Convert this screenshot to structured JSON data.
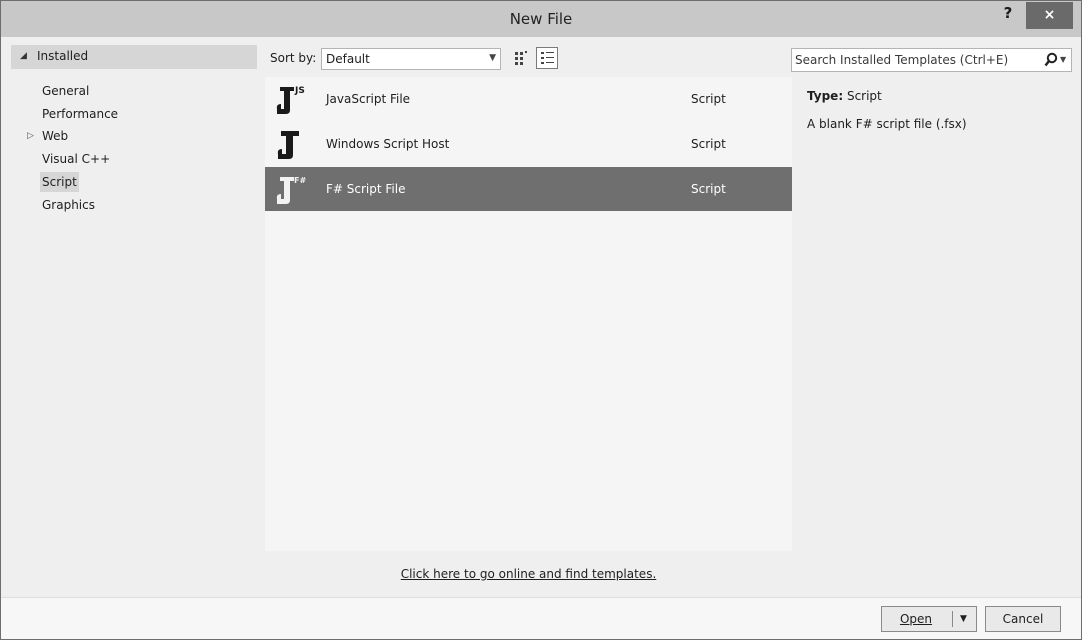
{
  "window": {
    "title": "New File",
    "help_label": "?",
    "close_label": "×"
  },
  "tree": {
    "root_label": "Installed",
    "items": [
      {
        "label": "General"
      },
      {
        "label": "Performance"
      },
      {
        "label": "Web"
      },
      {
        "label": "Visual C++"
      },
      {
        "label": "Script"
      },
      {
        "label": "Graphics"
      }
    ],
    "selected": "Script"
  },
  "toolbar": {
    "sort_label": "Sort by:",
    "sort_value": "Default"
  },
  "search": {
    "placeholder": "Search Installed Templates (Ctrl+E)"
  },
  "templates": [
    {
      "name": "JavaScript File",
      "type": "Script",
      "icon": "javascript-file-icon",
      "badge": "JS"
    },
    {
      "name": "Windows Script Host",
      "type": "Script",
      "icon": "windows-script-host-icon",
      "badge": ""
    },
    {
      "name": "F# Script File",
      "type": "Script",
      "icon": "fsharp-script-icon",
      "badge": "F#",
      "selected": true
    }
  ],
  "description": {
    "type_label": "Type:",
    "type_value": "Script",
    "text": "A blank F# script file (.fsx)"
  },
  "online_link": "Click here to go online and find templates.",
  "buttons": {
    "open": "Open",
    "cancel": "Cancel"
  }
}
